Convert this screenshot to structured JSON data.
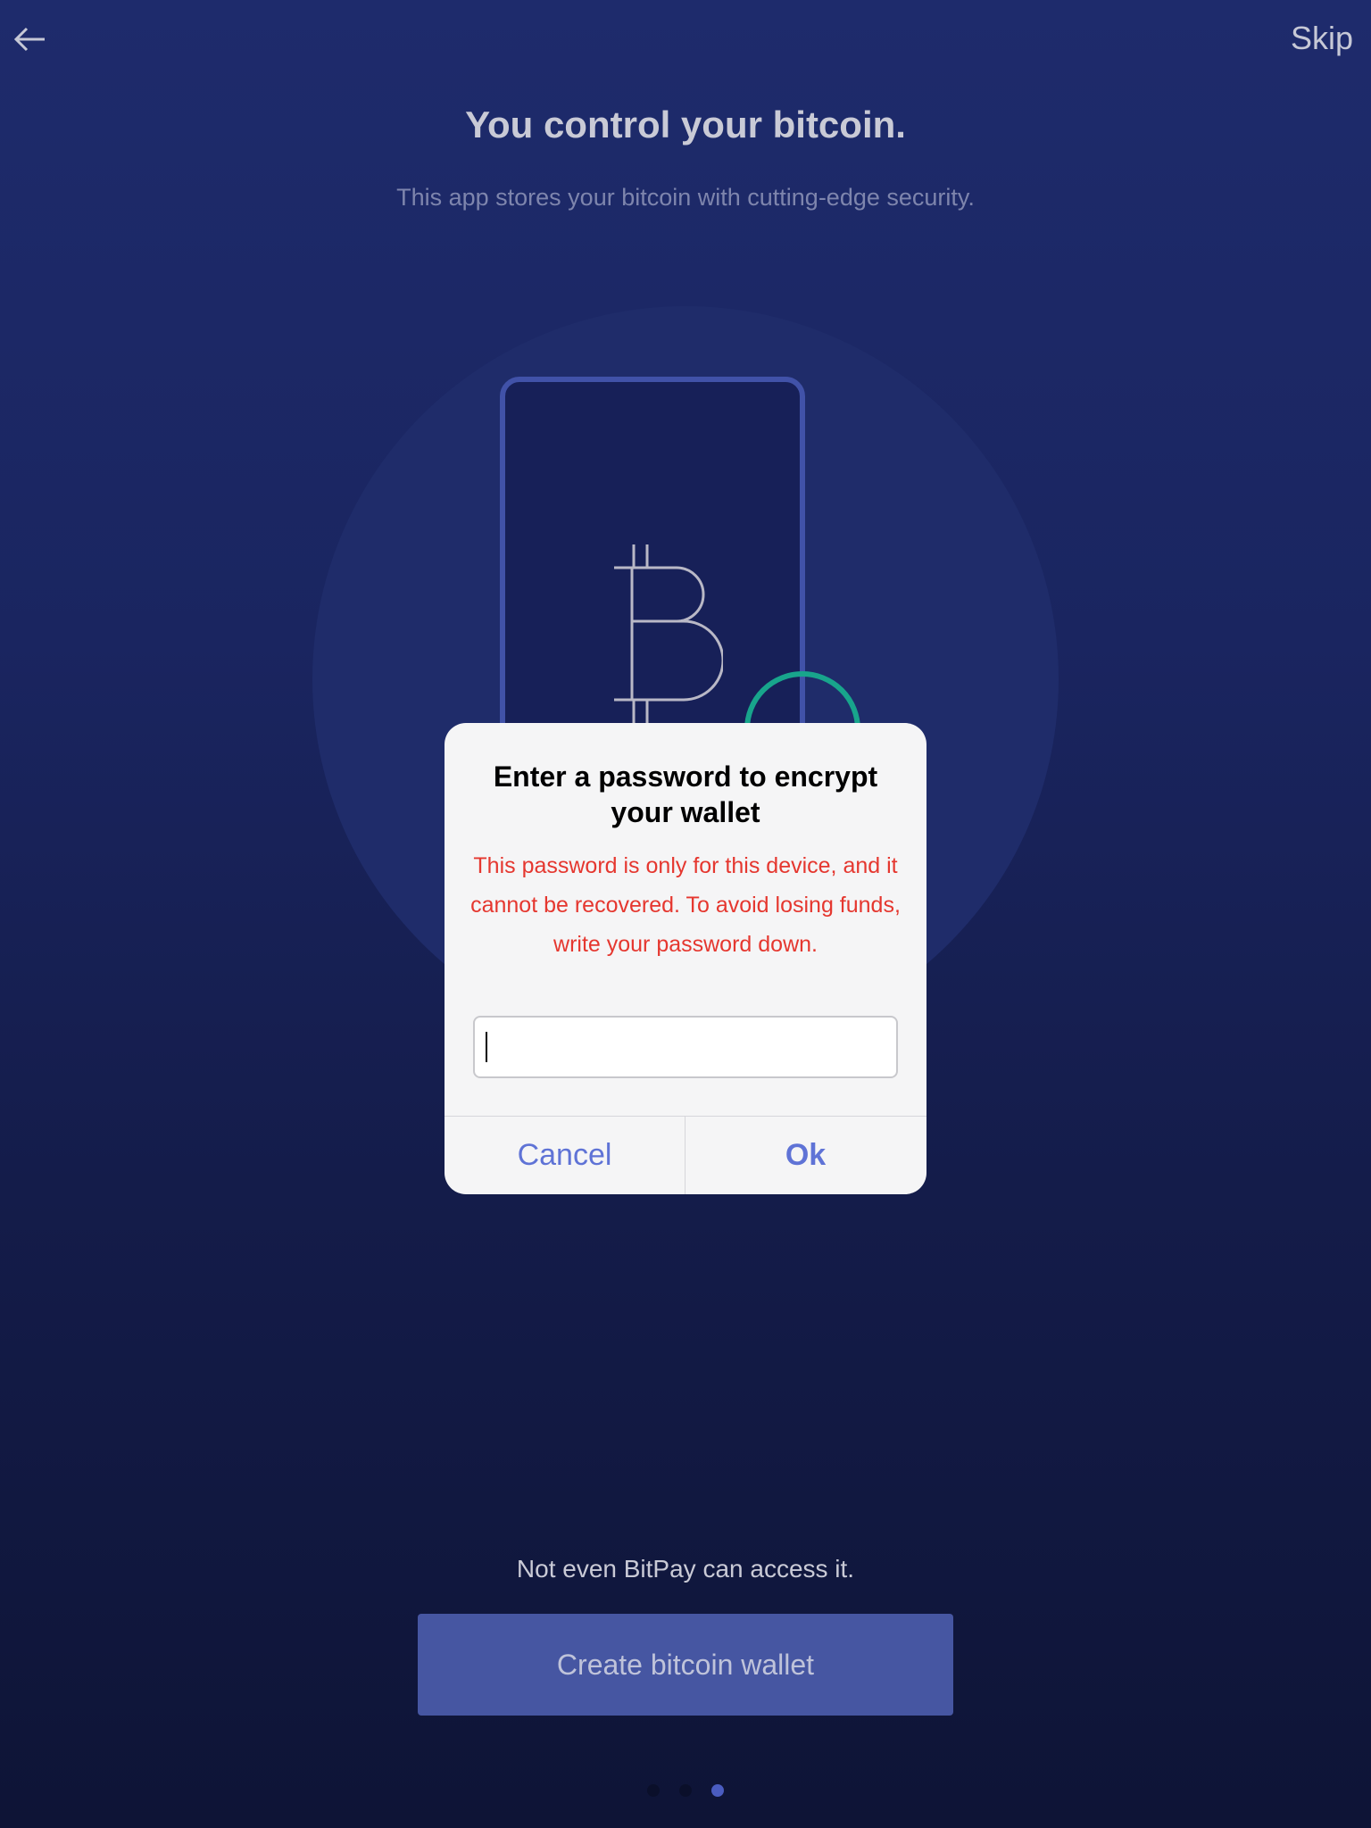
{
  "header": {
    "back_icon": "arrow-left-icon",
    "skip_label": "Skip"
  },
  "onboarding": {
    "title": "You control your bitcoin.",
    "subtitle": "This app stores your bitcoin with cutting-edge security.",
    "note": "Not even BitPay can access it.",
    "cta_label": "Create bitcoin wallet",
    "pagination": {
      "total": 3,
      "current": 3
    }
  },
  "illustration": {
    "icons": [
      "phone-icon",
      "bitcoin-icon",
      "checkmark-badge-icon"
    ]
  },
  "dialog": {
    "title": "Enter a password to encrypt your wallet",
    "message": "This password is only for this device, and it cannot be recovered. To avoid losing funds, write your password down.",
    "input_value": "",
    "cancel_label": "Cancel",
    "ok_label": "Ok"
  },
  "colors": {
    "background_top": "#1e2b6c",
    "background_bottom": "#0e1436",
    "accent": "#5f73d6",
    "warning_text": "#e5372f",
    "success": "#18a58c",
    "cta_background": "#4656a2"
  }
}
